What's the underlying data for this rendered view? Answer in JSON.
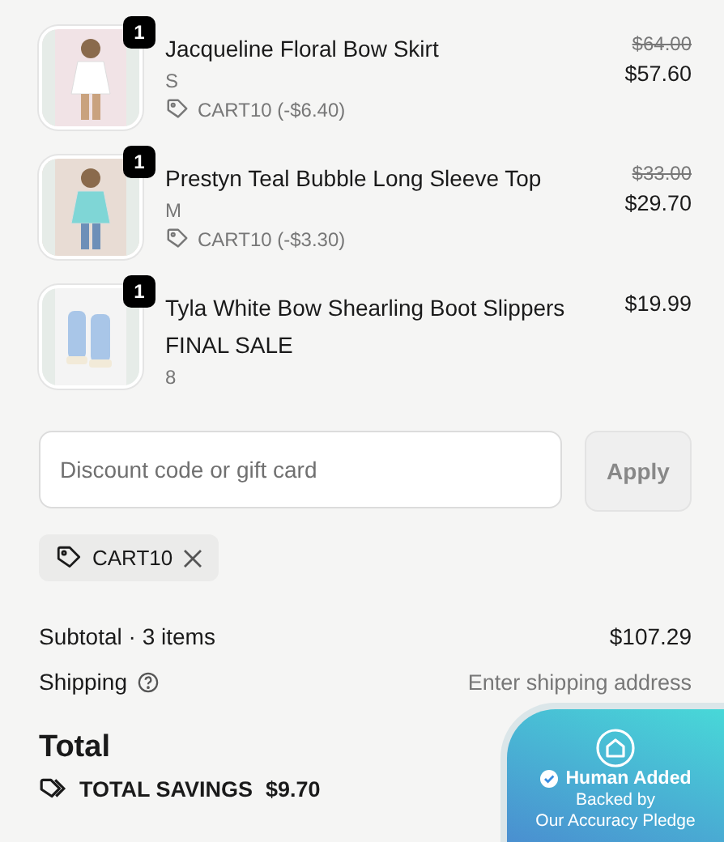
{
  "items": [
    {
      "name": "Jacqueline Floral Bow Skirt",
      "quantity": "1",
      "variant": "S",
      "discount": "CART10 (-$6.40)",
      "original_price": "$64.00",
      "price": "$57.60"
    },
    {
      "name": "Prestyn Teal Bubble Long Sleeve Top",
      "quantity": "1",
      "variant": "M",
      "discount": "CART10 (-$3.30)",
      "original_price": "$33.00",
      "price": "$29.70"
    },
    {
      "name": "Tyla White Bow Shearling Boot Slippers",
      "quantity": "1",
      "note": "FINAL SALE",
      "variant": "8",
      "price": "$19.99"
    }
  ],
  "discount_field": {
    "placeholder": "Discount code or gift card"
  },
  "apply_button": {
    "label": "Apply",
    "disabled": true
  },
  "applied_codes": [
    {
      "code": "CART10"
    }
  ],
  "subtotal": {
    "label": "Subtotal · 3 items",
    "value": "$107.29"
  },
  "shipping": {
    "label": "Shipping",
    "value": "Enter shipping address"
  },
  "total": {
    "label": "Total"
  },
  "savings": {
    "label": "TOTAL SAVINGS",
    "value": "$9.70"
  },
  "pledge_badge": {
    "title": "Human Added",
    "line_1": "Backed by",
    "line_2": "Our Accuracy Pledge"
  }
}
